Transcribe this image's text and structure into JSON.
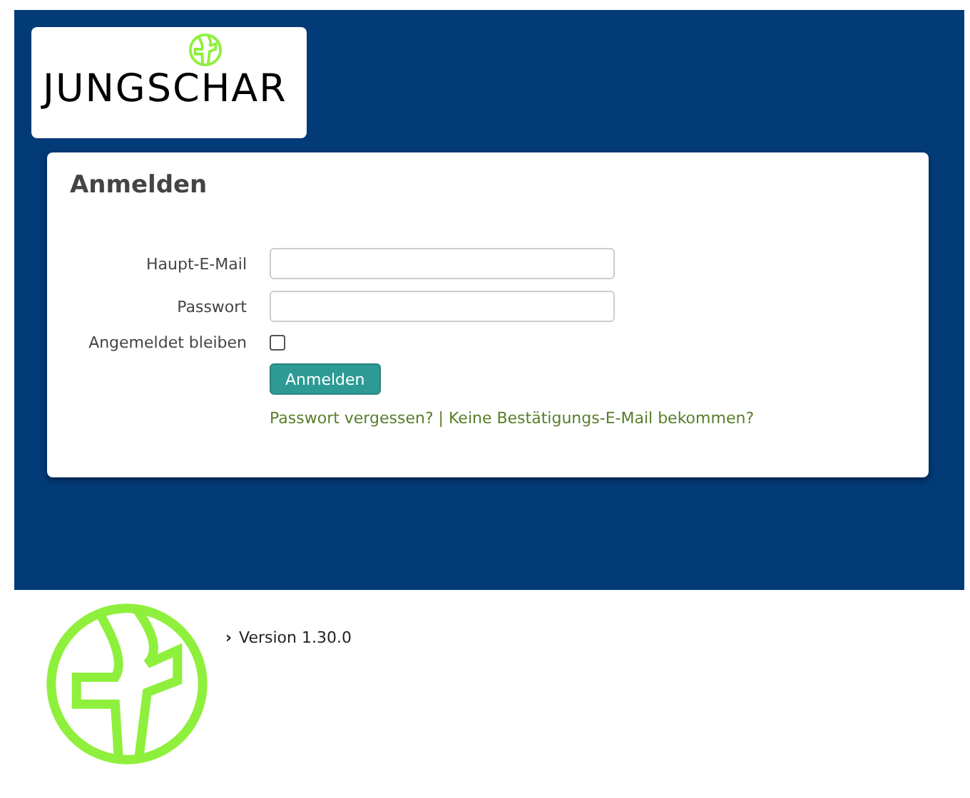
{
  "logo": {
    "text": "JUNGSCHAR"
  },
  "login": {
    "title": "Anmelden",
    "fields": [
      {
        "label": "Haupt-E-Mail"
      },
      {
        "label": "Passwort"
      }
    ],
    "remember": {
      "label": "Angemeldet bleiben",
      "checked": false
    },
    "submit": "Anmelden",
    "links": [
      {
        "text": "Passwort vergessen?"
      },
      {
        "text": "Keine Bestätigungs-E-Mail bekommen?"
      }
    ],
    "link_separator": "|"
  },
  "footer": {
    "version_marker": "›",
    "version": "Version 1.30.0"
  }
}
